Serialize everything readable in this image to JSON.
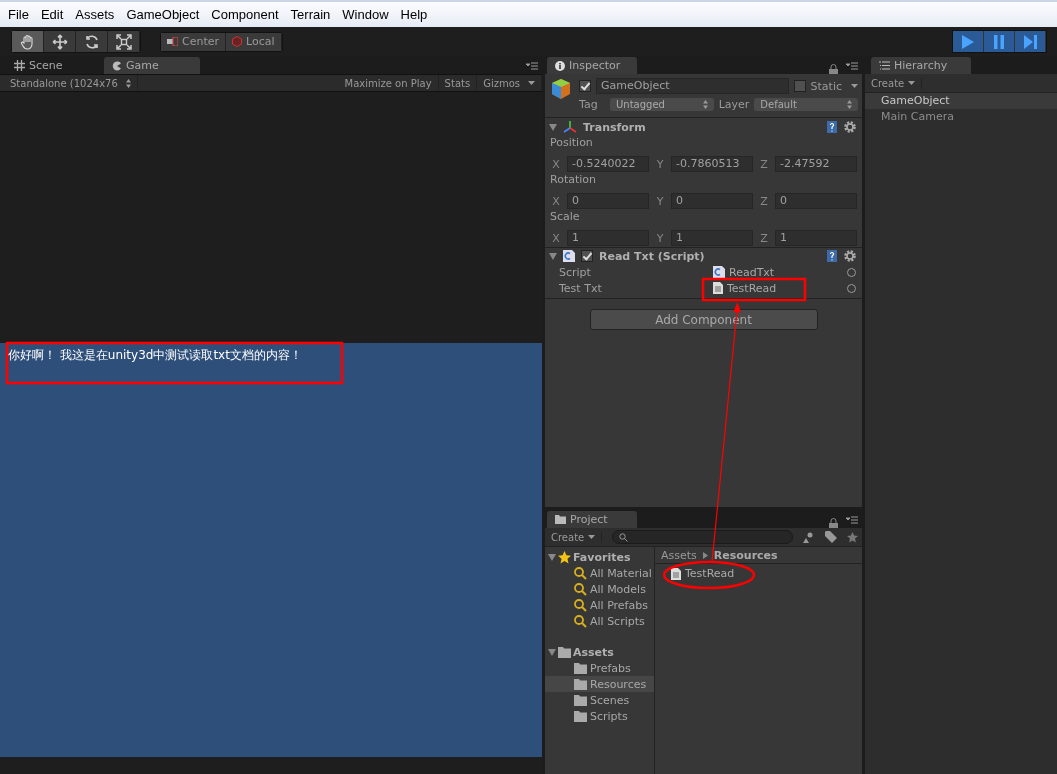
{
  "menu": [
    "File",
    "Edit",
    "Assets",
    "GameObject",
    "Component",
    "Terrain",
    "Window",
    "Help"
  ],
  "toolbar": {
    "tools": [
      {
        "kind": "hand",
        "selected": true
      },
      {
        "kind": "move",
        "selected": false
      },
      {
        "kind": "rotate",
        "selected": false
      },
      {
        "kind": "scale",
        "selected": false
      }
    ],
    "pivot": [
      "Center",
      "Local"
    ],
    "playback": [
      {
        "kind": "play",
        "on": true
      },
      {
        "kind": "pause",
        "on": true
      },
      {
        "kind": "step",
        "on": true
      }
    ]
  },
  "game_panel": {
    "tabs": [
      {
        "label": "Scene",
        "kind": "scene",
        "selected": false
      },
      {
        "label": "Game",
        "kind": "game",
        "selected": true
      }
    ],
    "resolution": "Standalone (1024x76",
    "buttons": [
      "Maximize on Play",
      "Stats",
      "Gizmos"
    ],
    "game_text": "你好啊！ 我这是在unity3d中测试读取txt文档的内容！"
  },
  "inspector": {
    "tab": "Inspector",
    "object": {
      "active": true,
      "name": "GameObject",
      "static": false,
      "static_label": "Static",
      "tag_label": "Tag",
      "tag": "Untagged",
      "layer_label": "Layer",
      "layer": "Default"
    },
    "transform": {
      "title": "Transform",
      "expanded": true,
      "properties": [
        {
          "label": "Position",
          "fields": [
            {
              "axis": "X",
              "value": "-0.5240022"
            },
            {
              "axis": "Y",
              "value": "-0.7860513"
            },
            {
              "axis": "Z",
              "value": "-2.47592"
            }
          ]
        },
        {
          "label": "Rotation",
          "fields": [
            {
              "axis": "X",
              "value": "0"
            },
            {
              "axis": "Y",
              "value": "0"
            },
            {
              "axis": "Z",
              "value": "0"
            }
          ]
        },
        {
          "label": "Scale",
          "fields": [
            {
              "axis": "X",
              "value": "1"
            },
            {
              "axis": "Y",
              "value": "1"
            },
            {
              "axis": "Z",
              "value": "1"
            }
          ]
        }
      ]
    },
    "script": {
      "title": "Read Txt (Script)",
      "expanded": true,
      "enabled": true,
      "fields": [
        {
          "label": "Script",
          "kind": "script",
          "value": "ReadTxt"
        },
        {
          "label": "Test Txt",
          "kind": "text",
          "value": "TestRead"
        }
      ]
    },
    "add_component": "Add Component"
  },
  "hierarchy": {
    "tab": "Hierarchy",
    "create": "Create",
    "items": [
      {
        "label": "GameObject",
        "selected": true
      },
      {
        "label": "Main Camera",
        "selected": false
      }
    ]
  },
  "project": {
    "tab": "Project",
    "create": "Create",
    "favorites": {
      "label": "Favorites",
      "expanded": true,
      "items": [
        "All Material",
        "All Models",
        "All Prefabs",
        "All Scripts"
      ]
    },
    "assets": {
      "label": "Assets",
      "expanded": true,
      "items": [
        {
          "label": "Prefabs",
          "selected": false
        },
        {
          "label": "Resources",
          "selected": true
        },
        {
          "label": "Scenes",
          "selected": false
        },
        {
          "label": "Scripts",
          "selected": false
        }
      ]
    },
    "breadcrumb": [
      "Assets",
      "Resources"
    ],
    "files": [
      "TestRead"
    ]
  }
}
